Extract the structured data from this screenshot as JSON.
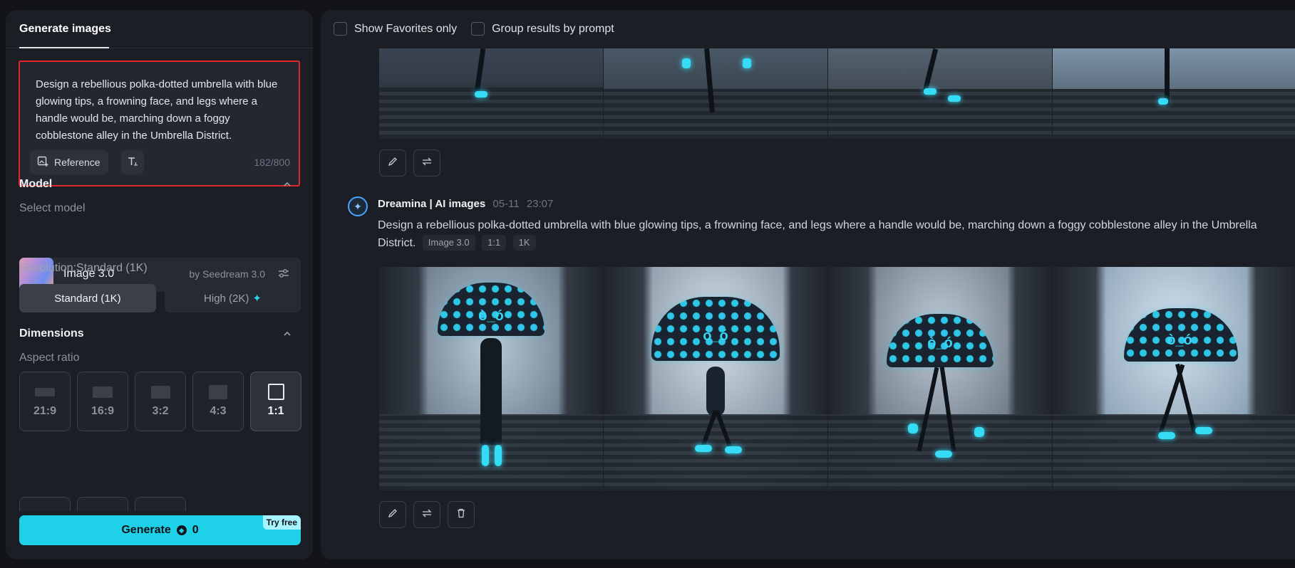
{
  "left_panel": {
    "tab_label": "Generate images",
    "prompt_text": "Design a rebellious polka-dotted umbrella with blue glowing tips, a frowning face, and legs where a handle would be, marching down a foggy cobblestone alley in the Umbrella District.",
    "reference_label": "Reference",
    "char_counter": "182/800",
    "model_section": {
      "title": "Model",
      "select_label": "Select model",
      "model_name": "Image 3.0",
      "model_by": "by Seedream 3.0"
    },
    "resolution": {
      "label": "Resolution:Standard (1K)",
      "options": [
        "Standard (1K)",
        "High (2K)"
      ],
      "selected": "Standard (1K)"
    },
    "dimensions": {
      "title": "Dimensions",
      "aspect_label": "Aspect ratio",
      "ratios": [
        "21:9",
        "16:9",
        "3:2",
        "4:3",
        "1:1"
      ],
      "selected": "1:1"
    },
    "generate": {
      "label": "Generate",
      "credits": "0",
      "badge": "Try free"
    }
  },
  "right_panel": {
    "filters": {
      "favorites_label": "Show Favorites only",
      "group_label": "Group results by prompt"
    },
    "entry": {
      "author": "Dreamina | AI images",
      "date": "05-11",
      "time": "23:07",
      "prompt": "Design a rebellious polka-dotted umbrella with blue glowing tips, a frowning face, and legs where a handle would be, marching down a foggy cobblestone alley in the Umbrella District.",
      "tags": [
        "Image 3.0",
        "1:1",
        "1K"
      ]
    }
  },
  "colors": {
    "accent": "#1fd0e9",
    "highlight_border": "#e02828",
    "panel_bg": "#1b1e25",
    "page_bg": "#121419"
  },
  "icons": [
    "reference-icon",
    "text-style-icon",
    "chevron-up-icon",
    "settings-sliders-icon",
    "sparkle-icon",
    "edit-icon",
    "regenerate-icon",
    "delete-icon",
    "dreamina-logo-icon",
    "coin-icon"
  ]
}
